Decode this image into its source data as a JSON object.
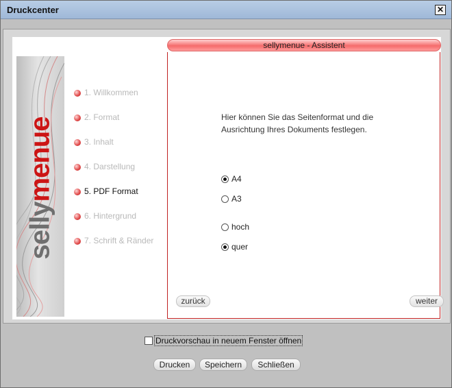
{
  "window": {
    "title": "Druckcenter",
    "close_glyph": "✕"
  },
  "assistant": {
    "header": "sellymenue - Assistent"
  },
  "brand": {
    "prefix": "selly",
    "accent": "menue"
  },
  "steps": [
    {
      "label": "1. Willkommen",
      "active": false
    },
    {
      "label": "2. Format",
      "active": false
    },
    {
      "label": "3. Inhalt",
      "active": false
    },
    {
      "label": "4. Darstellung",
      "active": false
    },
    {
      "label": "5. PDF Format",
      "active": true
    },
    {
      "label": "6. Hintergrund",
      "active": false
    },
    {
      "label": "7. Schrift & Ränder",
      "active": false
    }
  ],
  "content": {
    "intro": "Hier können Sie das Seitenformat und die Ausrichtung Ihres Dokuments festlegen.",
    "format_options": [
      {
        "label": "A4",
        "checked": true
      },
      {
        "label": "A3",
        "checked": false
      }
    ],
    "orientation_options": [
      {
        "label": "hoch",
        "checked": false
      },
      {
        "label": "quer",
        "checked": true
      }
    ]
  },
  "nav": {
    "back_label": "zurück",
    "next_label": "weiter"
  },
  "bottom": {
    "preview_label": "Druckvorschau in neuem Fenster öffnen",
    "preview_checked": false,
    "print_label": "Drucken",
    "save_label": "Speichern",
    "close_label": "Schließen"
  },
  "colors": {
    "accent": "#cc1515",
    "title_bar": "#aec3df",
    "panel_border": "#c02020"
  }
}
